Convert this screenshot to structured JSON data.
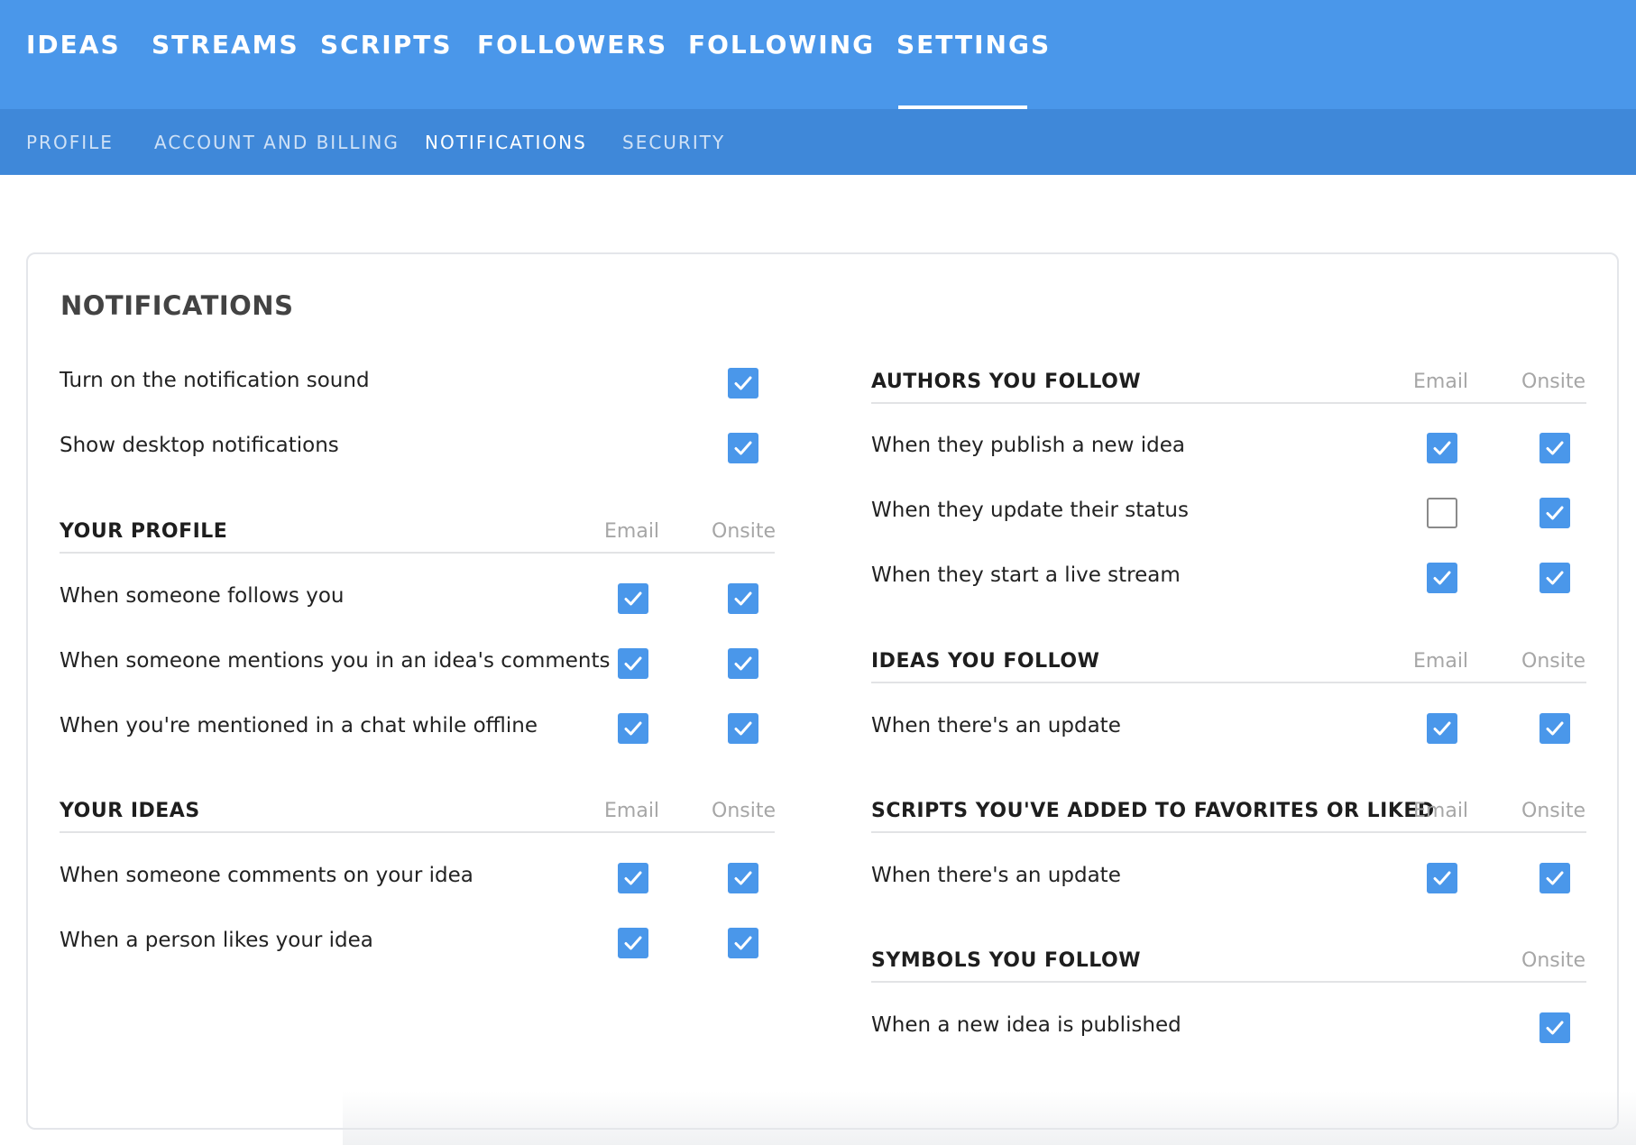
{
  "topnav": {
    "items": [
      {
        "label": "IDEAS"
      },
      {
        "label": "STREAMS"
      },
      {
        "label": "SCRIPTS"
      },
      {
        "label": "FOLLOWERS"
      },
      {
        "label": "FOLLOWING"
      },
      {
        "label": "SETTINGS",
        "active": true
      }
    ]
  },
  "subnav": {
    "items": [
      {
        "label": "PROFILE"
      },
      {
        "label": "ACCOUNT AND BILLING"
      },
      {
        "label": "NOTIFICATIONS",
        "active": true
      },
      {
        "label": "SECURITY"
      }
    ]
  },
  "card": {
    "title": "NOTIFICATIONS",
    "general": [
      {
        "label": "Turn on the notification sound",
        "checked": true
      },
      {
        "label": "Show desktop notifications",
        "checked": true
      }
    ],
    "your_profile": {
      "heading": "YOUR PROFILE",
      "col_email": "Email",
      "col_onsite": "Onsite",
      "rows": [
        {
          "label": "When someone follows you",
          "email": true,
          "onsite": true
        },
        {
          "label": "When someone mentions you in an idea's comments",
          "email": true,
          "onsite": true
        },
        {
          "label": "When you're mentioned in a chat while offline",
          "email": true,
          "onsite": true
        }
      ]
    },
    "your_ideas": {
      "heading": "YOUR IDEAS",
      "col_email": "Email",
      "col_onsite": "Onsite",
      "rows": [
        {
          "label": "When someone comments on your idea",
          "email": true,
          "onsite": true
        },
        {
          "label": "When a person likes your idea",
          "email": true,
          "onsite": true
        }
      ]
    },
    "authors_you_follow": {
      "heading": "AUTHORS YOU FOLLOW",
      "col_email": "Email",
      "col_onsite": "Onsite",
      "rows": [
        {
          "label": "When they publish a new idea",
          "email": true,
          "onsite": true
        },
        {
          "label": "When they update their status",
          "email": false,
          "onsite": true
        },
        {
          "label": "When they start a live stream",
          "email": true,
          "onsite": true
        }
      ]
    },
    "ideas_you_follow": {
      "heading": "IDEAS YOU FOLLOW",
      "col_email": "Email",
      "col_onsite": "Onsite",
      "rows": [
        {
          "label": "When there's an update",
          "email": true,
          "onsite": true
        }
      ]
    },
    "scripts_favorites": {
      "heading": "SCRIPTS YOU'VE ADDED TO FAVORITES OR LIKED",
      "col_email": "Email",
      "col_onsite": "Onsite",
      "rows": [
        {
          "label": "When there's an update",
          "email": true,
          "onsite": true
        }
      ]
    },
    "symbols_you_follow": {
      "heading": "SYMBOLS YOU FOLLOW",
      "col_onsite": "Onsite",
      "rows": [
        {
          "label": "When a new idea is published",
          "onsite": true
        }
      ]
    }
  },
  "colors": {
    "accent": "#4a97ea",
    "subnav": "#3f88d9",
    "unchecked_border": "#8a8a8a"
  }
}
